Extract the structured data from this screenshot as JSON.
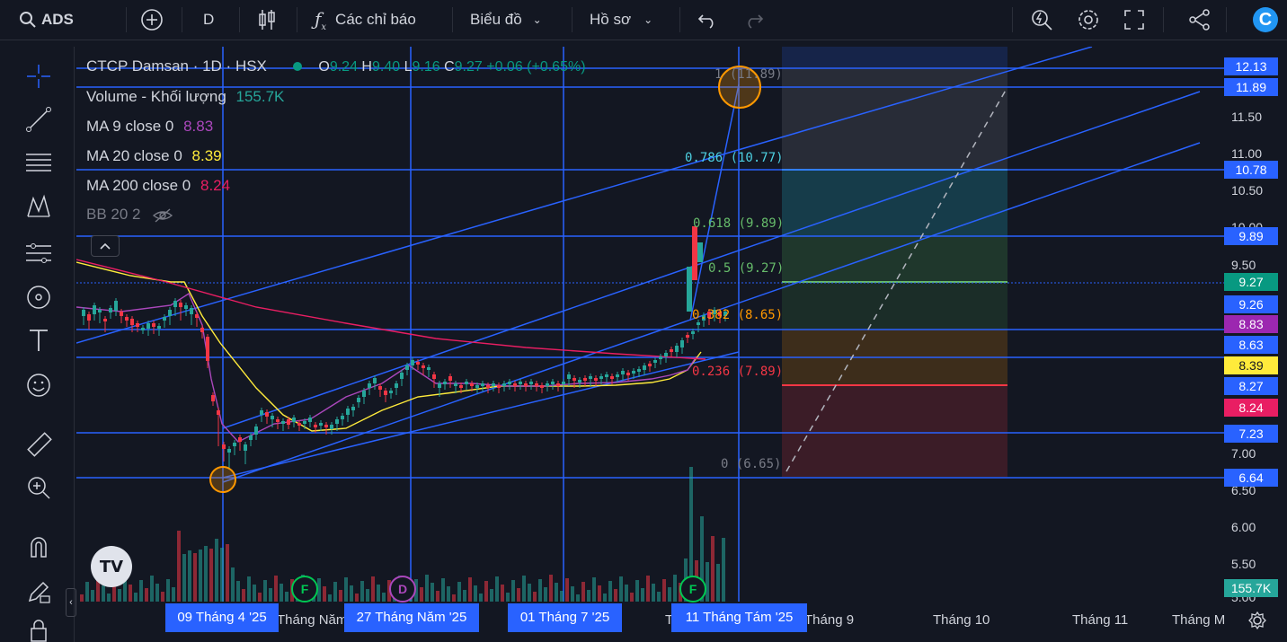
{
  "toolbar": {
    "symbol": "ADS",
    "interval": "D",
    "indicators_label": "Các chỉ báo",
    "layout_label": "Biểu đồ",
    "profile_label": "Hồ sơ",
    "logo_letter": "C"
  },
  "legend": {
    "title": "CTCP Damsan · 1D · HSX",
    "o_label": "O",
    "o_value": "9.24",
    "h_label": "H",
    "h_value": "9.40",
    "l_label": "L",
    "l_value": "9.16",
    "c_label": "C",
    "c_value": "9.27",
    "change": "+0.06 (+0.65%)",
    "volume_label": "Volume - Khối lượng",
    "volume_value": "155.7K",
    "ma9_label": "MA 9 close 0",
    "ma9_value": "8.83",
    "ma20_label": "MA 20 close 0",
    "ma20_value": "8.39",
    "ma200_label": "MA 200 close 0",
    "ma200_value": "8.24",
    "bb_label": "BB 20 2"
  },
  "fib_levels": [
    {
      "label": "1 (11.89)",
      "color": "#787b86"
    },
    {
      "label": "0.786 (10.77)",
      "color": "#4dd0e1"
    },
    {
      "label": "0.618 (9.89)",
      "color": "#66bb6a"
    },
    {
      "label": "0.5 (9.27)",
      "color": "#66bb6a"
    },
    {
      "label": "0.382 (8.65)",
      "color": "#ff9800"
    },
    {
      "label": "0.236 (7.89)",
      "color": "#f23645"
    },
    {
      "label": "0 (6.65)",
      "color": "#787b86"
    }
  ],
  "price_axis": [
    "11.50",
    "11.00",
    "10.50",
    "10.00",
    "9.50",
    "7.00",
    "6.50",
    "6.00",
    "5.50",
    "5.00"
  ],
  "price_tags": [
    {
      "value": "12.13",
      "bg": "#2962ff"
    },
    {
      "value": "11.89",
      "bg": "#2962ff"
    },
    {
      "value": "10.78",
      "bg": "#2962ff"
    },
    {
      "value": "9.89",
      "bg": "#2962ff"
    },
    {
      "value": "9.27",
      "bg": "#089981"
    },
    {
      "value": "9.26",
      "bg": "#2962ff"
    },
    {
      "value": "8.83",
      "bg": "#9c27b0"
    },
    {
      "value": "8.63",
      "bg": "#2962ff"
    },
    {
      "value": "8.39",
      "bg": "#ffeb3b"
    },
    {
      "value": "8.27",
      "bg": "#2962ff"
    },
    {
      "value": "8.24",
      "bg": "#e91e63"
    },
    {
      "value": "7.23",
      "bg": "#2962ff"
    },
    {
      "value": "6.64",
      "bg": "#2962ff"
    },
    {
      "value": "155.7K",
      "bg": "#26a69a"
    }
  ],
  "time_axis": [
    "Tháng Năm",
    "Tháng 9",
    "Tháng 10",
    "Tháng 11",
    "Tháng M",
    "T"
  ],
  "time_tags": [
    "09 Tháng 4 '25",
    "27 Tháng Năm '25",
    "01 Tháng 7 '25",
    "11 Tháng Tám '25"
  ],
  "events": [
    {
      "letter": "F",
      "color": "#00c853"
    },
    {
      "letter": "D",
      "color": "#ab47bc"
    },
    {
      "letter": "F",
      "color": "#00c853"
    }
  ],
  "colors": {
    "up": "#26a69a",
    "down": "#f23645",
    "line": "#2962ff",
    "ma9": "#ab47bc",
    "ma20": "#ffeb3b",
    "ma200": "#e91e63"
  }
}
